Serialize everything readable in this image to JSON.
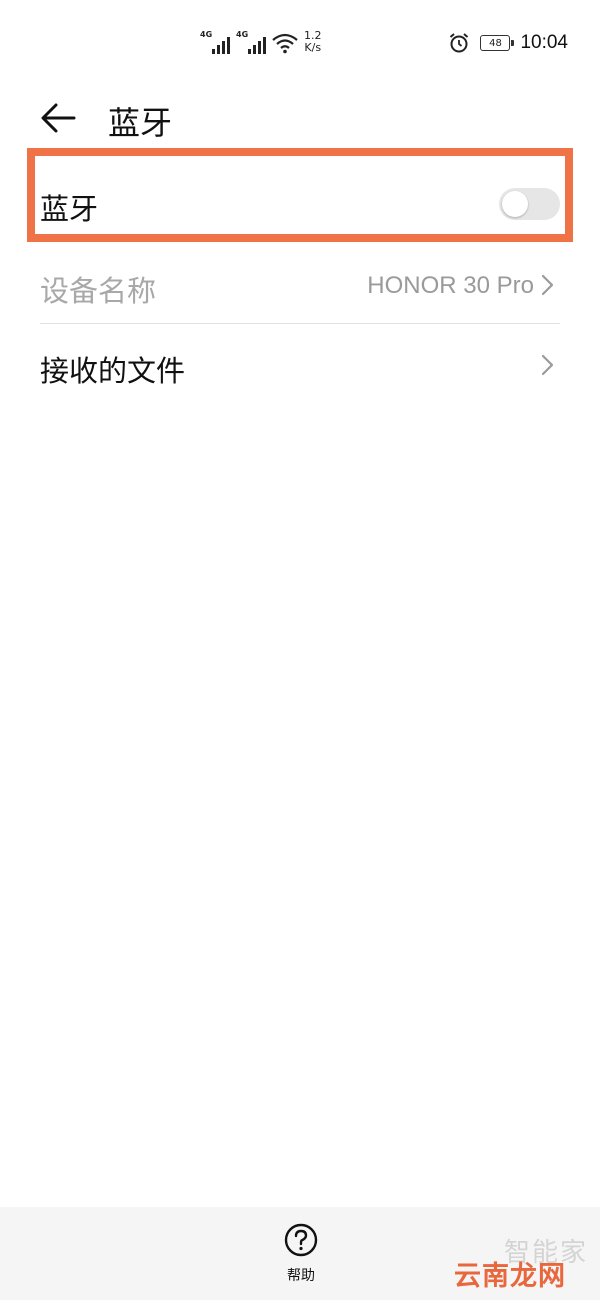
{
  "status_bar": {
    "network_1": "4G",
    "network_2": "4G",
    "speed_value": "1.2",
    "speed_unit": "K/s",
    "battery_level": "48",
    "time": "10:04",
    "icons": [
      "signal-icon",
      "wifi-icon",
      "alarm-icon",
      "battery-icon"
    ]
  },
  "header": {
    "back_icon": "arrow-left-icon",
    "title": "蓝牙"
  },
  "bluetooth_row": {
    "label": "蓝牙",
    "enabled": false,
    "highlight_color": "#f07347"
  },
  "device_name_row": {
    "label": "设备名称",
    "value": "HONOR 30 Pro",
    "disabled": true
  },
  "received_files_row": {
    "label": "接收的文件"
  },
  "bottom_bar": {
    "help_label": "帮助",
    "help_icon": "question-circle-icon"
  },
  "watermark": {
    "line1": "智能家",
    "line2": "云南龙网",
    "color": "#e8673d"
  }
}
